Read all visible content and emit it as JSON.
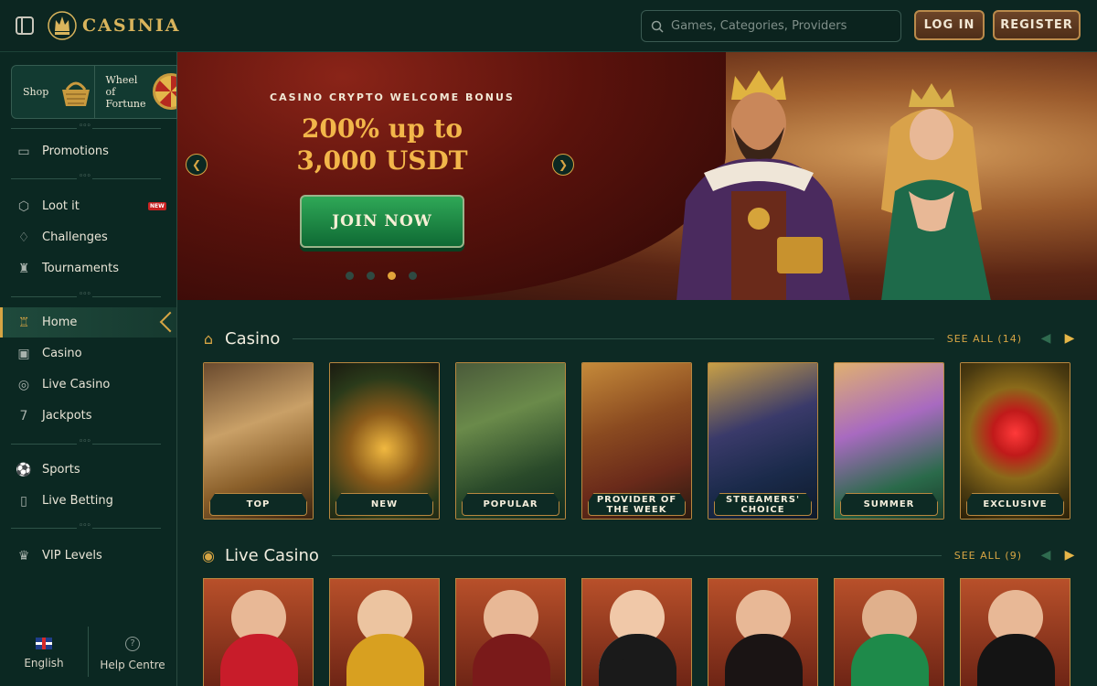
{
  "header": {
    "logo_text": "CASINIA",
    "search_placeholder": "Games, Categories, Providers",
    "login_label": "LOG IN",
    "register_label": "REGISTER"
  },
  "sidebar": {
    "tiles": [
      {
        "label": "Shop"
      },
      {
        "label_line1": "Wheel",
        "label_line2": "of",
        "label_line3": "Fortune"
      }
    ],
    "items": [
      {
        "label": "Promotions",
        "icon": "gift-box-icon"
      },
      {
        "label": "Loot it",
        "icon": "loot-box-icon",
        "badge": "NEW"
      },
      {
        "label": "Challenges",
        "icon": "bell-icon"
      },
      {
        "label": "Tournaments",
        "icon": "trophy-icon"
      },
      {
        "label": "Home",
        "icon": "castle-icon",
        "active": true
      },
      {
        "label": "Casino",
        "icon": "slot-machine-icon"
      },
      {
        "label": "Live Casino",
        "icon": "chip-icon"
      },
      {
        "label": "Jackpots",
        "icon": "seven-icon"
      },
      {
        "label": "Sports",
        "icon": "soccer-ball-icon"
      },
      {
        "label": "Live Betting",
        "icon": "live-betting-icon"
      },
      {
        "label": "VIP Levels",
        "icon": "crown-icon"
      }
    ],
    "footer": {
      "language_label": "English",
      "help_label": "Help Centre"
    }
  },
  "hero": {
    "subtitle": "CASINO CRYPTO WELCOME BONUS",
    "title_line1": "200% up to",
    "title_line2": "3,000 USDT",
    "cta_label": "JOIN NOW",
    "slides_total": 4,
    "slide_active": 3
  },
  "casino_section": {
    "title": "Casino",
    "see_all": "SEE ALL (14)",
    "cards": [
      {
        "label": "TOP"
      },
      {
        "label": "NEW"
      },
      {
        "label": "POPULAR"
      },
      {
        "label": "PROVIDER OF THE WEEK"
      },
      {
        "label": "STREAMERS' CHOICE"
      },
      {
        "label": "SUMMER"
      },
      {
        "label": "EXCLUSIVE"
      }
    ]
  },
  "live_section": {
    "title": "Live Casino",
    "see_all": "SEE ALL (9)",
    "card_count": 7
  },
  "colors": {
    "background": "#0d2a24",
    "accent_gold": "#d7a544",
    "cta_green": "#1f8a45",
    "hero_title": "#f2b64a"
  }
}
